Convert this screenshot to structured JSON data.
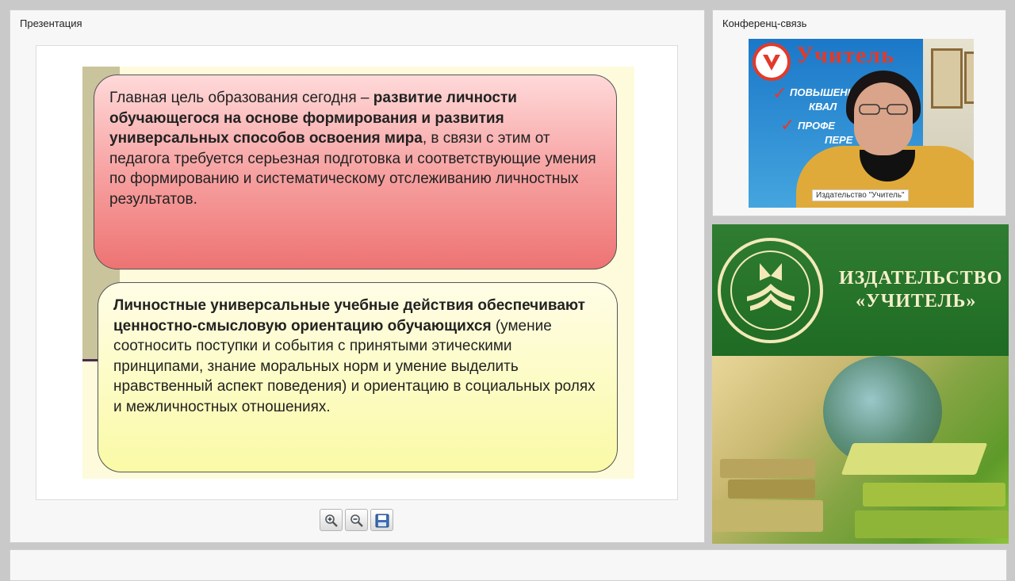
{
  "presentation": {
    "title": "Презентация",
    "slide": {
      "box1": {
        "t1": "Главная цель образования сегодня – ",
        "b1": "развитие личности обучающегося на основе формирования и развития универсальных способов освоения мира",
        "t2": ", в связи с этим от педагога требуется серьезная подготовка и соответствующие умения по формированию и систематическому отслеживанию личностных результатов."
      },
      "box2": {
        "b1": "Личностные универсальные учебные действия обеспечивают ценностно-смысловую ориентацию обучающихся",
        "t1": " (умение соотносить поступки и события с принятыми этическими принципами, знание моральных норм и умение выделить нравственный аспект поведения) и ориентацию в социальных ролях и межличностных отношениях."
      }
    },
    "toolbar": [
      "zoom-in-icon",
      "zoom-out-icon",
      "save-icon"
    ]
  },
  "conference": {
    "title": "Конференц-связь",
    "video": {
      "logo_text": "Учитель",
      "words": [
        "ПОВЫШЕНИ",
        "КВАЛ",
        "ПРОФЕ",
        "ПЕРЕ"
      ],
      "label": "Издательство \"Учитель\""
    }
  },
  "publisher": {
    "name_line1": "ИЗДАТЕЛЬСТВО",
    "name_line2": "«УЧИТЕЛЬ»"
  },
  "colors": {
    "red_box": "#f7a2a2",
    "yellow_box": "#fafaa6",
    "publisher_green": "#2f7d31"
  }
}
